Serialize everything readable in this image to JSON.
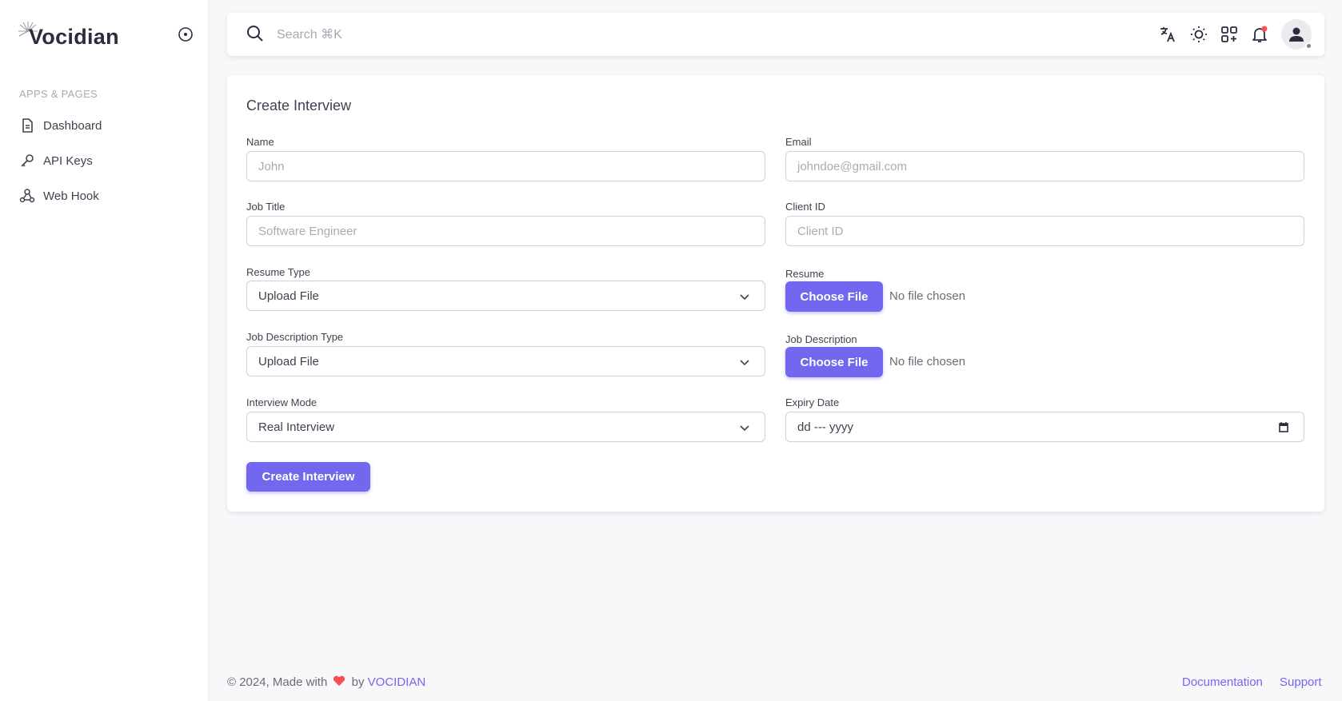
{
  "sidebar": {
    "logo": "Vocidian",
    "section": "APPS & PAGES",
    "items": [
      {
        "label": "Dashboard",
        "icon": "file-text-icon"
      },
      {
        "label": "API Keys",
        "icon": "key-icon"
      },
      {
        "label": "Web Hook",
        "icon": "webhook-icon"
      }
    ]
  },
  "header": {
    "search_placeholder": "Search ⌘K",
    "icons": [
      "translate-icon",
      "sun-icon",
      "apps-add-icon",
      "bell-icon",
      "avatar"
    ]
  },
  "form": {
    "title": "Create Interview",
    "name": {
      "label": "Name",
      "placeholder": "John"
    },
    "email": {
      "label": "Email",
      "placeholder": "johndoe@gmail.com"
    },
    "job_title": {
      "label": "Job Title",
      "placeholder": "Software Engineer"
    },
    "client_id": {
      "label": "Client ID",
      "placeholder": "Client ID"
    },
    "resume_type": {
      "label": "Resume Type",
      "value": "Upload File"
    },
    "resume": {
      "label": "Resume",
      "button": "Choose File",
      "status": "No file chosen"
    },
    "jd_type": {
      "label": "Job Description Type",
      "value": "Upload File"
    },
    "jd": {
      "label": "Job Description",
      "button": "Choose File",
      "status": "No file chosen"
    },
    "mode": {
      "label": "Interview Mode",
      "value": "Real Interview"
    },
    "expiry": {
      "label": "Expiry Date",
      "placeholder": "dd --- yyyy"
    },
    "submit": "Create Interview"
  },
  "footer": {
    "prefix": "© 2024, Made with",
    "by": "by",
    "brand": "VOCIDIAN",
    "links": [
      "Documentation",
      "Support"
    ]
  },
  "colors": {
    "primary": "#7367f0",
    "heart": "#ff4c51",
    "notification": "#ff4c51"
  }
}
